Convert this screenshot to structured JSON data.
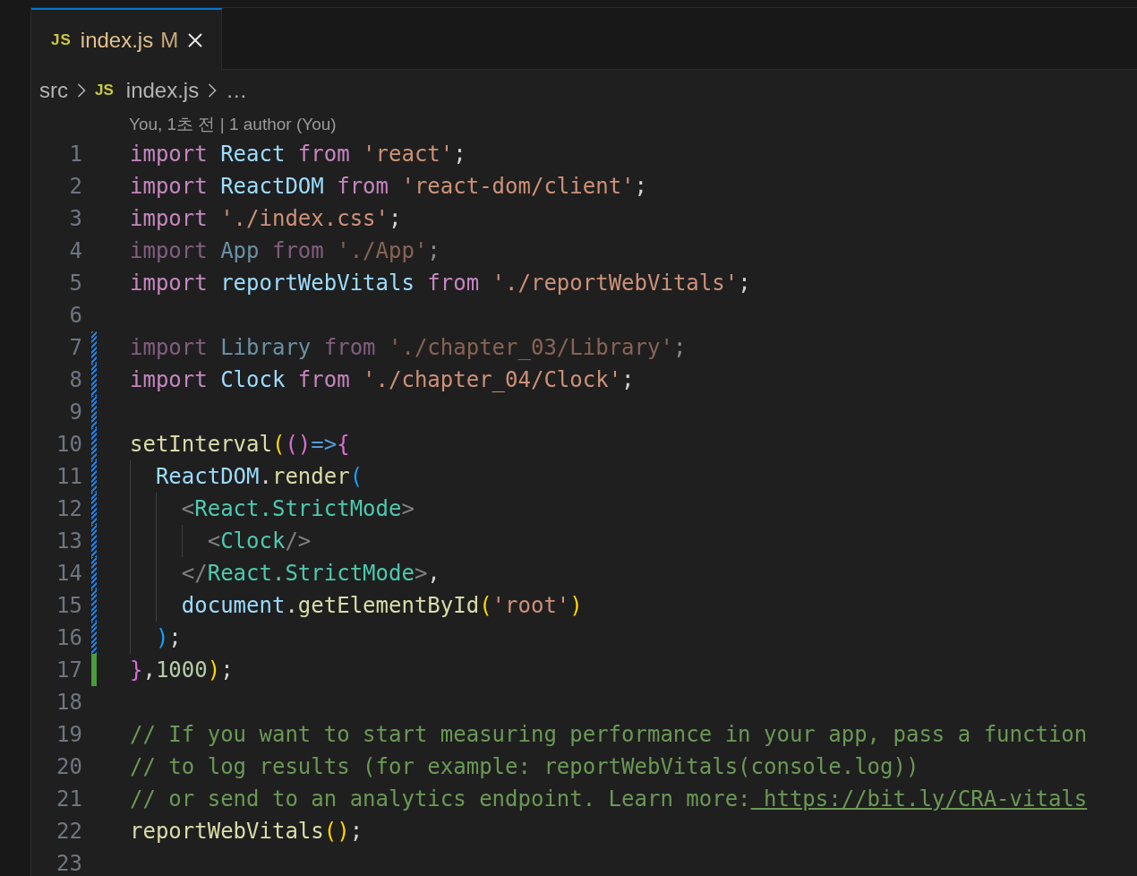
{
  "tabs": [
    {
      "file_icon": "JS",
      "label": "index.js",
      "git_status": "M",
      "selected": true
    }
  ],
  "breadcrumbs": {
    "items": [
      {
        "label": "src"
      },
      {
        "file_icon": "JS",
        "label": "index.js"
      },
      {
        "label": "…"
      }
    ]
  },
  "codelens": "You, 1초 전 | 1 author (You)",
  "lines": [
    {
      "number": "1",
      "modified": false,
      "added": false,
      "dimmed": false,
      "tokens": [
        {
          "text": "import",
          "kind": "keyword"
        },
        {
          "text": " React",
          "kind": "variable"
        },
        {
          "text": " from",
          "kind": "keyword"
        },
        {
          "text": " 'react'",
          "kind": "string"
        },
        {
          "text": ";",
          "kind": "plain"
        }
      ]
    },
    {
      "number": "2",
      "modified": false,
      "added": false,
      "dimmed": false,
      "tokens": [
        {
          "text": "import",
          "kind": "keyword"
        },
        {
          "text": " ReactDOM",
          "kind": "variable"
        },
        {
          "text": " from",
          "kind": "keyword"
        },
        {
          "text": " 'react-dom/client'",
          "kind": "string"
        },
        {
          "text": ";",
          "kind": "plain"
        }
      ]
    },
    {
      "number": "3",
      "modified": false,
      "added": false,
      "dimmed": false,
      "tokens": [
        {
          "text": "import",
          "kind": "keyword"
        },
        {
          "text": " './index.css'",
          "kind": "string"
        },
        {
          "text": ";",
          "kind": "plain"
        }
      ]
    },
    {
      "number": "4",
      "modified": false,
      "added": false,
      "dimmed": true,
      "tokens": [
        {
          "text": "import",
          "kind": "keyword"
        },
        {
          "text": " App",
          "kind": "variable"
        },
        {
          "text": " from",
          "kind": "keyword"
        },
        {
          "text": " './App'",
          "kind": "string"
        },
        {
          "text": ";",
          "kind": "plain"
        }
      ]
    },
    {
      "number": "5",
      "modified": false,
      "added": false,
      "dimmed": false,
      "tokens": [
        {
          "text": "import",
          "kind": "keyword"
        },
        {
          "text": " reportWebVitals",
          "kind": "variable"
        },
        {
          "text": " from",
          "kind": "keyword"
        },
        {
          "text": " './reportWebVitals'",
          "kind": "string"
        },
        {
          "text": ";",
          "kind": "plain"
        }
      ]
    },
    {
      "number": "6",
      "modified": false,
      "added": false
    },
    {
      "number": "7",
      "modified": true,
      "added": false,
      "dimmed": true,
      "tokens": [
        {
          "text": "import",
          "kind": "keyword"
        },
        {
          "text": " Library",
          "kind": "variable"
        },
        {
          "text": " from",
          "kind": "keyword"
        },
        {
          "text": " './chapter_03/Library'",
          "kind": "string"
        },
        {
          "text": ";",
          "kind": "plain"
        }
      ]
    },
    {
      "number": "8",
      "modified": true,
      "added": false,
      "dimmed": false,
      "tokens": [
        {
          "text": "import",
          "kind": "keyword"
        },
        {
          "text": " Clock",
          "kind": "variable"
        },
        {
          "text": " from",
          "kind": "keyword"
        },
        {
          "text": " './chapter_04/Clock'",
          "kind": "string"
        },
        {
          "text": ";",
          "kind": "plain"
        }
      ]
    },
    {
      "number": "9",
      "modified": true,
      "added": false
    },
    {
      "number": "10",
      "modified": true,
      "added": false,
      "dimmed": false,
      "tokens": [
        {
          "text": "setInterval",
          "kind": "function"
        },
        {
          "text": "(",
          "kind": "bracket1"
        },
        {
          "text": "()",
          "kind": "bracket2"
        },
        {
          "text": "=>",
          "kind": "arrow"
        },
        {
          "text": "{",
          "kind": "bracket2"
        }
      ]
    },
    {
      "number": "11",
      "modified": true,
      "added": false,
      "dimmed": false,
      "tokens": [
        {
          "text": "  ReactDOM",
          "kind": "variable"
        },
        {
          "text": ".",
          "kind": "plain"
        },
        {
          "text": "render",
          "kind": "function"
        },
        {
          "text": "(",
          "kind": "bracket3"
        }
      ]
    },
    {
      "number": "12",
      "modified": true,
      "added": false,
      "dimmed": false,
      "tokens": [
        {
          "text": "    <",
          "kind": "tagpunct"
        },
        {
          "text": "React.StrictMode",
          "kind": "component"
        },
        {
          "text": ">",
          "kind": "tagpunct"
        }
      ]
    },
    {
      "number": "13",
      "modified": true,
      "added": false,
      "dimmed": false,
      "tokens": [
        {
          "text": "      <",
          "kind": "tagpunct"
        },
        {
          "text": "Clock",
          "kind": "component"
        },
        {
          "text": "/>",
          "kind": "tagpunct"
        }
      ]
    },
    {
      "number": "14",
      "modified": true,
      "added": false,
      "dimmed": false,
      "tokens": [
        {
          "text": "    </",
          "kind": "tagpunct"
        },
        {
          "text": "React.StrictMode",
          "kind": "component"
        },
        {
          "text": ">",
          "kind": "tagpunct"
        },
        {
          "text": ",",
          "kind": "plain"
        }
      ]
    },
    {
      "number": "15",
      "modified": true,
      "added": false,
      "dimmed": false,
      "tokens": [
        {
          "text": "    document",
          "kind": "variable"
        },
        {
          "text": ".",
          "kind": "plain"
        },
        {
          "text": "getElementById",
          "kind": "function"
        },
        {
          "text": "(",
          "kind": "bracket1"
        },
        {
          "text": "'root'",
          "kind": "string"
        },
        {
          "text": ")",
          "kind": "bracket1"
        }
      ]
    },
    {
      "number": "16",
      "modified": true,
      "added": false,
      "dimmed": false,
      "tokens": [
        {
          "text": "  )",
          "kind": "bracket3"
        },
        {
          "text": ";",
          "kind": "plain"
        }
      ]
    },
    {
      "number": "17",
      "modified": false,
      "added": true,
      "dimmed": false,
      "tokens": [
        {
          "text": "}",
          "kind": "bracket2"
        },
        {
          "text": ",",
          "kind": "plain"
        },
        {
          "text": "1000",
          "kind": "number"
        },
        {
          "text": ")",
          "kind": "bracket1"
        },
        {
          "text": ";",
          "kind": "plain"
        }
      ]
    },
    {
      "number": "18",
      "modified": false,
      "added": false
    },
    {
      "number": "19",
      "modified": false,
      "added": false,
      "dimmed": false,
      "tokens": [
        {
          "text": "// If you want to start measuring performance in your app, pass a function",
          "kind": "comment"
        }
      ]
    },
    {
      "number": "20",
      "modified": false,
      "added": false,
      "dimmed": false,
      "tokens": [
        {
          "text": "// to log results (for example: reportWebVitals(console.log))",
          "kind": "comment"
        }
      ]
    },
    {
      "number": "21",
      "modified": false,
      "added": false,
      "dimmed": false,
      "tokens": [
        {
          "text": "// or send to an analytics endpoint. Learn more:",
          "kind": "comment"
        },
        {
          "text": " https://bit.ly/CRA-vitals",
          "kind": "link"
        }
      ]
    },
    {
      "number": "22",
      "modified": false,
      "added": false,
      "dimmed": false,
      "tokens": [
        {
          "text": "reportWebVitals",
          "kind": "function"
        },
        {
          "text": "()",
          "kind": "bracket1"
        },
        {
          "text": ";",
          "kind": "plain"
        }
      ]
    },
    {
      "number": "23",
      "modified": false,
      "added": false
    }
  ]
}
